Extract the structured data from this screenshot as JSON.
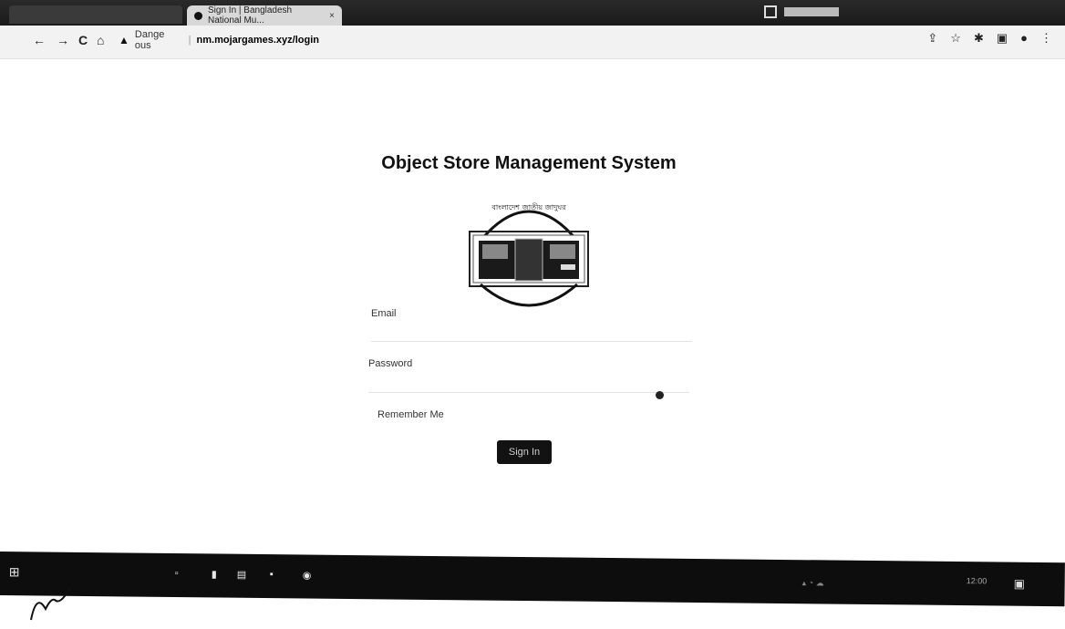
{
  "browser": {
    "active_tab_title": "Sign In | Bangladesh National Mu...",
    "tab_close": "×",
    "nav": {
      "back": "←",
      "forward": "→",
      "reload": "C",
      "home": "⌂"
    },
    "security_label": "Dange  ous",
    "url": "nm.mojargames.xyz/login",
    "toolbar_icons": [
      "share-icon",
      "star-icon",
      "extensions-icon",
      "sidebar-icon",
      "profile-icon",
      "menu-icon"
    ]
  },
  "page": {
    "title": "Object Store Management System",
    "logo_arc_text": "বাংলাদেশ জাতীয় জাদুঘর",
    "email_label": "Email",
    "email_value": "",
    "password_label": "Password",
    "password_value": "",
    "remember_label": "Remember Me",
    "signin_label": "Sign In"
  },
  "taskbar": {
    "start_icon": "windows-start-icon",
    "clock_time": "12:00",
    "clock_date": ""
  },
  "colors": {
    "background": "#ffffff",
    "button": "#121212",
    "taskbar": "#0d0d0d"
  }
}
